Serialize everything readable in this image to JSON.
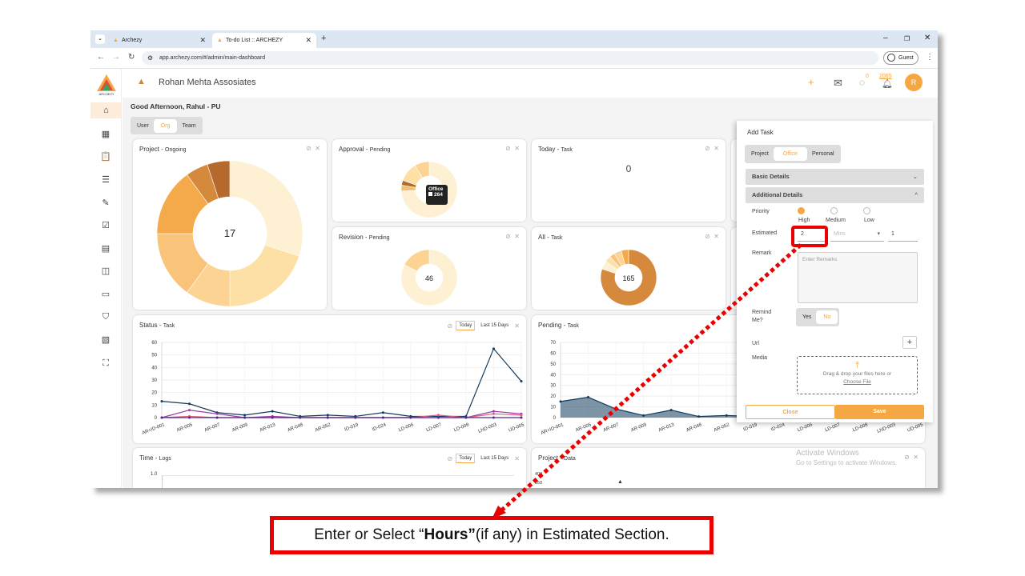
{
  "browser": {
    "tabs": [
      {
        "title": "Archezy",
        "active": false
      },
      {
        "title": "To-do List :: ARCHEZY",
        "active": true
      }
    ],
    "url": "app.archezy.com/#/admin/main-dashboard",
    "guest_label": "Guest"
  },
  "brand": {
    "logo_text": "ARCHEZY",
    "accent_color": "#f4a742"
  },
  "header": {
    "company": "Rohan Mehta Assosiates",
    "chat_count": "0",
    "bell_count": "2065",
    "avatar_initial": "R"
  },
  "greeting": "Good Afternoon, Rahul - PU",
  "scope_tabs": {
    "items": [
      "User",
      "Org",
      "Team"
    ],
    "selected": "Org"
  },
  "cards": {
    "project": {
      "title": "Project",
      "sub": "Ongoing",
      "center": "17"
    },
    "approval": {
      "title": "Approval",
      "sub": "Pending",
      "tooltip_label": "Office",
      "tooltip_value": "264"
    },
    "today": {
      "title": "Today",
      "sub": "Task",
      "value": "0"
    },
    "revision": {
      "title": "Revision",
      "sub": "Pending",
      "center": "46"
    },
    "all": {
      "title": "All",
      "sub": "Task",
      "center": "165"
    },
    "status": {
      "title": "Status",
      "sub": "Task",
      "today_btn": "Today",
      "last_btn": "Last 15 Days"
    },
    "pending": {
      "title": "Pending",
      "sub": "Task"
    },
    "time": {
      "title": "Time",
      "sub": "Logs",
      "today_btn": "Today",
      "last_btn": "Last 15 Days",
      "ytick": "1.0"
    },
    "project_data": {
      "title": "Project",
      "sub": "Data",
      "yticks": [
        "400",
        "350"
      ]
    }
  },
  "chart_data": [
    {
      "type": "pie",
      "title": "Project - Ongoing",
      "center_label": "17",
      "values": [
        6,
        4,
        2,
        3,
        3,
        1,
        1
      ],
      "colors": [
        "#fdf0d3",
        "#fde0a6",
        "#fcd393",
        "#f9c47a",
        "#f4aa4a",
        "#d4893c",
        "#b5692c"
      ]
    },
    {
      "type": "pie",
      "title": "Approval - Pending",
      "values": [
        264,
        12,
        10,
        40,
        30
      ],
      "colors": [
        "#fdf0d3",
        "#f2c070",
        "#b5692c",
        "#fde0a6",
        "#fcd393"
      ]
    },
    {
      "type": "pie",
      "title": "Revision - Pending",
      "center_label": "46",
      "values": [
        38,
        8
      ],
      "colors": [
        "#fdf0d3",
        "#fcd393"
      ]
    },
    {
      "type": "pie",
      "title": "All - Task",
      "center_label": "165",
      "values": [
        132,
        8,
        6,
        5,
        7,
        7
      ],
      "colors": [
        "#d4893c",
        "#fdf0d3",
        "#fde0a6",
        "#f9c47a",
        "#fcd393",
        "#f4aa4a"
      ]
    },
    {
      "type": "line",
      "title": "Status - Task",
      "categories": [
        "AR+ID-001",
        "AR-005",
        "AR-007",
        "AR-009",
        "AR-013",
        "AR-048",
        "AR-052",
        "ID-019",
        "ID-024",
        "LD-006",
        "LD-007",
        "LD-008",
        "LND-003",
        "UD-005"
      ],
      "ylim": [
        0,
        60
      ],
      "yticks": [
        0,
        10,
        20,
        30,
        40,
        50,
        60
      ],
      "grid": true,
      "series": [
        {
          "color": "#123a5c",
          "values": [
            13,
            11,
            4,
            2,
            5,
            1,
            2,
            1,
            4,
            1,
            1,
            1,
            55,
            29
          ]
        },
        {
          "color": "#9b3aa5",
          "values": [
            0,
            6,
            3,
            0,
            1,
            0,
            0,
            0,
            0,
            0,
            0,
            0,
            5,
            3
          ]
        },
        {
          "color": "#e05b7f",
          "values": [
            0,
            1,
            0,
            0,
            0,
            0,
            0,
            0,
            0,
            0,
            2,
            0,
            3,
            2
          ]
        },
        {
          "color": "#4b2a8a",
          "values": [
            0,
            0,
            0,
            0,
            0,
            0,
            0,
            0,
            0,
            0,
            0,
            0,
            0,
            0
          ]
        }
      ]
    },
    {
      "type": "area",
      "title": "Pending - Task",
      "categories": [
        "AR+ID-001",
        "AR-005",
        "AR-007",
        "AR-009",
        "AR-013",
        "AR-048",
        "AR-052",
        "ID-019",
        "ID-024",
        "LD-006",
        "LD-007",
        "LD-008",
        "LND-003",
        "UD-005"
      ],
      "ylim": [
        0,
        70
      ],
      "yticks": [
        0,
        10,
        20,
        30,
        40,
        50,
        60,
        70
      ],
      "grid": true,
      "series": [
        {
          "color": "#123a5c",
          "values": [
            15,
            19,
            8,
            2,
            7,
            1,
            2,
            1,
            1,
            1,
            1,
            1,
            1,
            1
          ]
        }
      ]
    }
  ],
  "add_task": {
    "title": "Add Task",
    "type_tabs": {
      "items": [
        "Project",
        "Office",
        "Personal"
      ],
      "selected": "Office"
    },
    "basic_details": "Basic Details",
    "additional_details": "Additional Details",
    "priority_label": "Priority",
    "priorities": [
      "High",
      "Medium",
      "Low"
    ],
    "priority_selected": "High",
    "estimated_label": "Estimated",
    "estimated_value": "2",
    "estimated_unit_placeholder": "Mins",
    "estimated_extra": "1",
    "remark_label": "Remark",
    "remark_placeholder": "Enter Remarks",
    "remind_label_1": "Remind",
    "remind_label_2": "Me?",
    "remind_options": [
      "Yes",
      "No"
    ],
    "remind_selected": "No",
    "url_label": "Url",
    "media_label": "Media",
    "drop_text": "Drag & drop your files here or",
    "choose_file": "Choose File",
    "close_btn": "Close",
    "save_btn": "Save"
  },
  "watermark": {
    "line1": "Activate Windows",
    "line2": "Go to Settings to activate Windows."
  },
  "instruction": {
    "pre": "Enter or Select “",
    "bold": "Hours”",
    "post": " (if any) in Estimated Section."
  }
}
